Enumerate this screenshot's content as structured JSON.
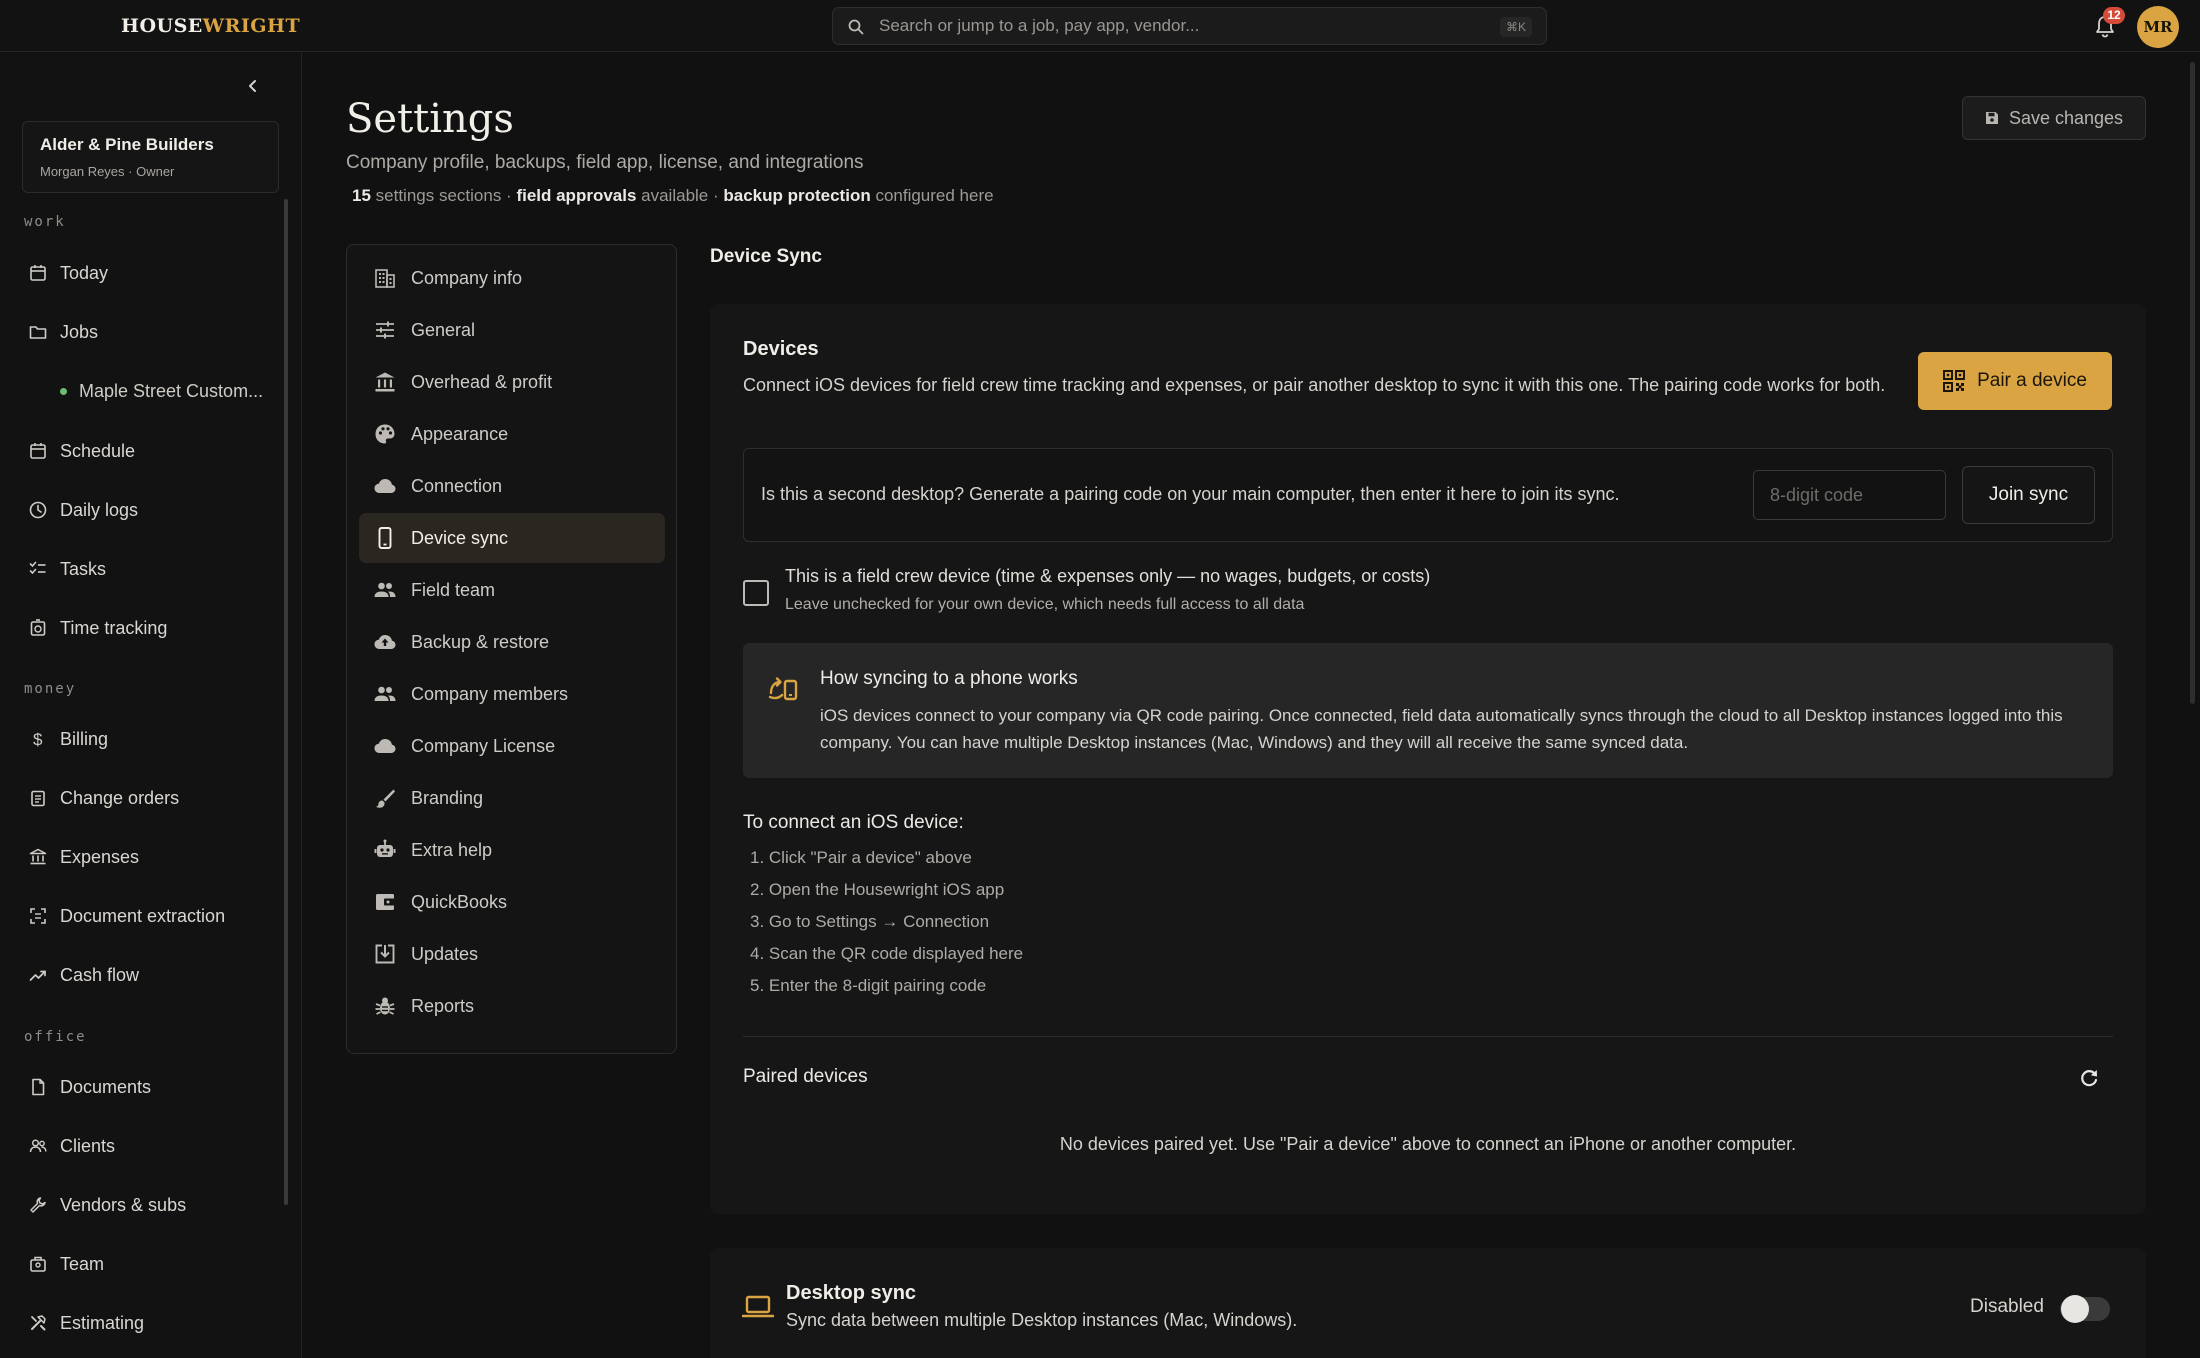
{
  "app": {
    "logo_part1": "HOUSE",
    "logo_part2": "WRIGHT",
    "accent_color": "#d9a441"
  },
  "topbar": {
    "search_placeholder": "Search or jump to a job, pay app, vendor...",
    "search_shortcut": "⌘K",
    "notification_count": "12",
    "avatar_initials": "MR"
  },
  "sidebar": {
    "company_name": "Alder & Pine Builders",
    "company_user": "Morgan Reyes · Owner",
    "sections": {
      "work": "work",
      "money": "money",
      "office": "office"
    },
    "work_items": [
      {
        "label": "Today",
        "icon": "calendar-icon"
      },
      {
        "label": "Jobs",
        "icon": "folder-icon"
      },
      {
        "label": "Maple Street Custom...",
        "icon": "status-dot"
      },
      {
        "label": "Schedule",
        "icon": "calendar-icon"
      },
      {
        "label": "Daily logs",
        "icon": "clock-icon"
      },
      {
        "label": "Tasks",
        "icon": "checklist-icon"
      },
      {
        "label": "Time tracking",
        "icon": "stopwatch-icon"
      }
    ],
    "money_items": [
      {
        "label": "Billing",
        "icon": "dollar-icon"
      },
      {
        "label": "Change orders",
        "icon": "clipboard-icon"
      },
      {
        "label": "Expenses",
        "icon": "bank-icon"
      },
      {
        "label": "Document extraction",
        "icon": "scan-icon"
      },
      {
        "label": "Cash flow",
        "icon": "trend-icon"
      }
    ],
    "office_items": [
      {
        "label": "Documents",
        "icon": "document-icon"
      },
      {
        "label": "Clients",
        "icon": "people-icon"
      },
      {
        "label": "Vendors & subs",
        "icon": "wrench-icon"
      },
      {
        "label": "Team",
        "icon": "team-icon"
      },
      {
        "label": "Estimating",
        "icon": "tools-icon"
      }
    ]
  },
  "page": {
    "title": "Settings",
    "subtitle": "Company profile, backups, field app, license, and integrations",
    "meta_count": "15",
    "meta_sections": " settings sections · ",
    "meta_field": "field approvals",
    "meta_available": " available · ",
    "meta_backup": "backup protection",
    "meta_configured": " configured here",
    "save_label": "Save changes"
  },
  "settings_menu": [
    {
      "label": "Company info",
      "icon": "building-icon",
      "active": false
    },
    {
      "label": "General",
      "icon": "sliders-icon",
      "active": false
    },
    {
      "label": "Overhead & profit",
      "icon": "bank-icon",
      "active": false
    },
    {
      "label": "Appearance",
      "icon": "palette-icon",
      "active": false
    },
    {
      "label": "Connection",
      "icon": "cloud-icon",
      "active": false
    },
    {
      "label": "Device sync",
      "icon": "phone-icon",
      "active": true
    },
    {
      "label": "Field team",
      "icon": "people-icon",
      "active": false
    },
    {
      "label": "Backup & restore",
      "icon": "cloud-upload-icon",
      "active": false
    },
    {
      "label": "Company members",
      "icon": "people-icon",
      "active": false
    },
    {
      "label": "Company License",
      "icon": "cloud-icon",
      "active": false
    },
    {
      "label": "Branding",
      "icon": "brush-icon",
      "active": false
    },
    {
      "label": "Extra help",
      "icon": "robot-icon",
      "active": false
    },
    {
      "label": "QuickBooks",
      "icon": "wallet-icon",
      "active": false
    },
    {
      "label": "Updates",
      "icon": "download-icon",
      "active": false
    },
    {
      "label": "Reports",
      "icon": "bug-icon",
      "active": false
    }
  ],
  "device_sync": {
    "section_title": "Device Sync",
    "devices_heading": "Devices",
    "devices_desc": "Connect iOS devices for field crew time tracking and expenses, or pair another desktop to sync it with this one. The pairing code works for both.",
    "pair_label": "Pair a device",
    "join_prompt": "Is this a second desktop? Generate a pairing code on your main computer, then enter it here to join its sync.",
    "code_placeholder": "8-digit code",
    "join_label": "Join sync",
    "field_crew_label": "This is a field crew device (time & expenses only — no wages, budgets, or costs)",
    "field_crew_hint": "Leave unchecked for your own device, which needs full access to all data",
    "info_heading": "How syncing to a phone works",
    "info_text": "iOS devices connect to your company via QR code pairing. Once connected, field data automatically syncs through the cloud to all Desktop instances logged into this company. You can have multiple Desktop instances (Mac, Windows) and they will all receive the same synced data.",
    "steps_heading": "To connect an iOS device:",
    "steps": [
      "1. Click \"Pair a device\" above",
      "2. Open the Housewright iOS app",
      "3. Go to Settings → Connection",
      "4. Scan the QR code displayed here",
      "5. Enter the 8-digit pairing code"
    ],
    "paired_heading": "Paired devices",
    "empty_message": "No devices paired yet. Use \"Pair a device\" above to connect an iPhone or another computer."
  },
  "desktop_sync": {
    "heading": "Desktop sync",
    "subtitle": "Sync data between multiple Desktop instances (Mac, Windows).",
    "state_label": "Disabled",
    "enabled": false
  }
}
